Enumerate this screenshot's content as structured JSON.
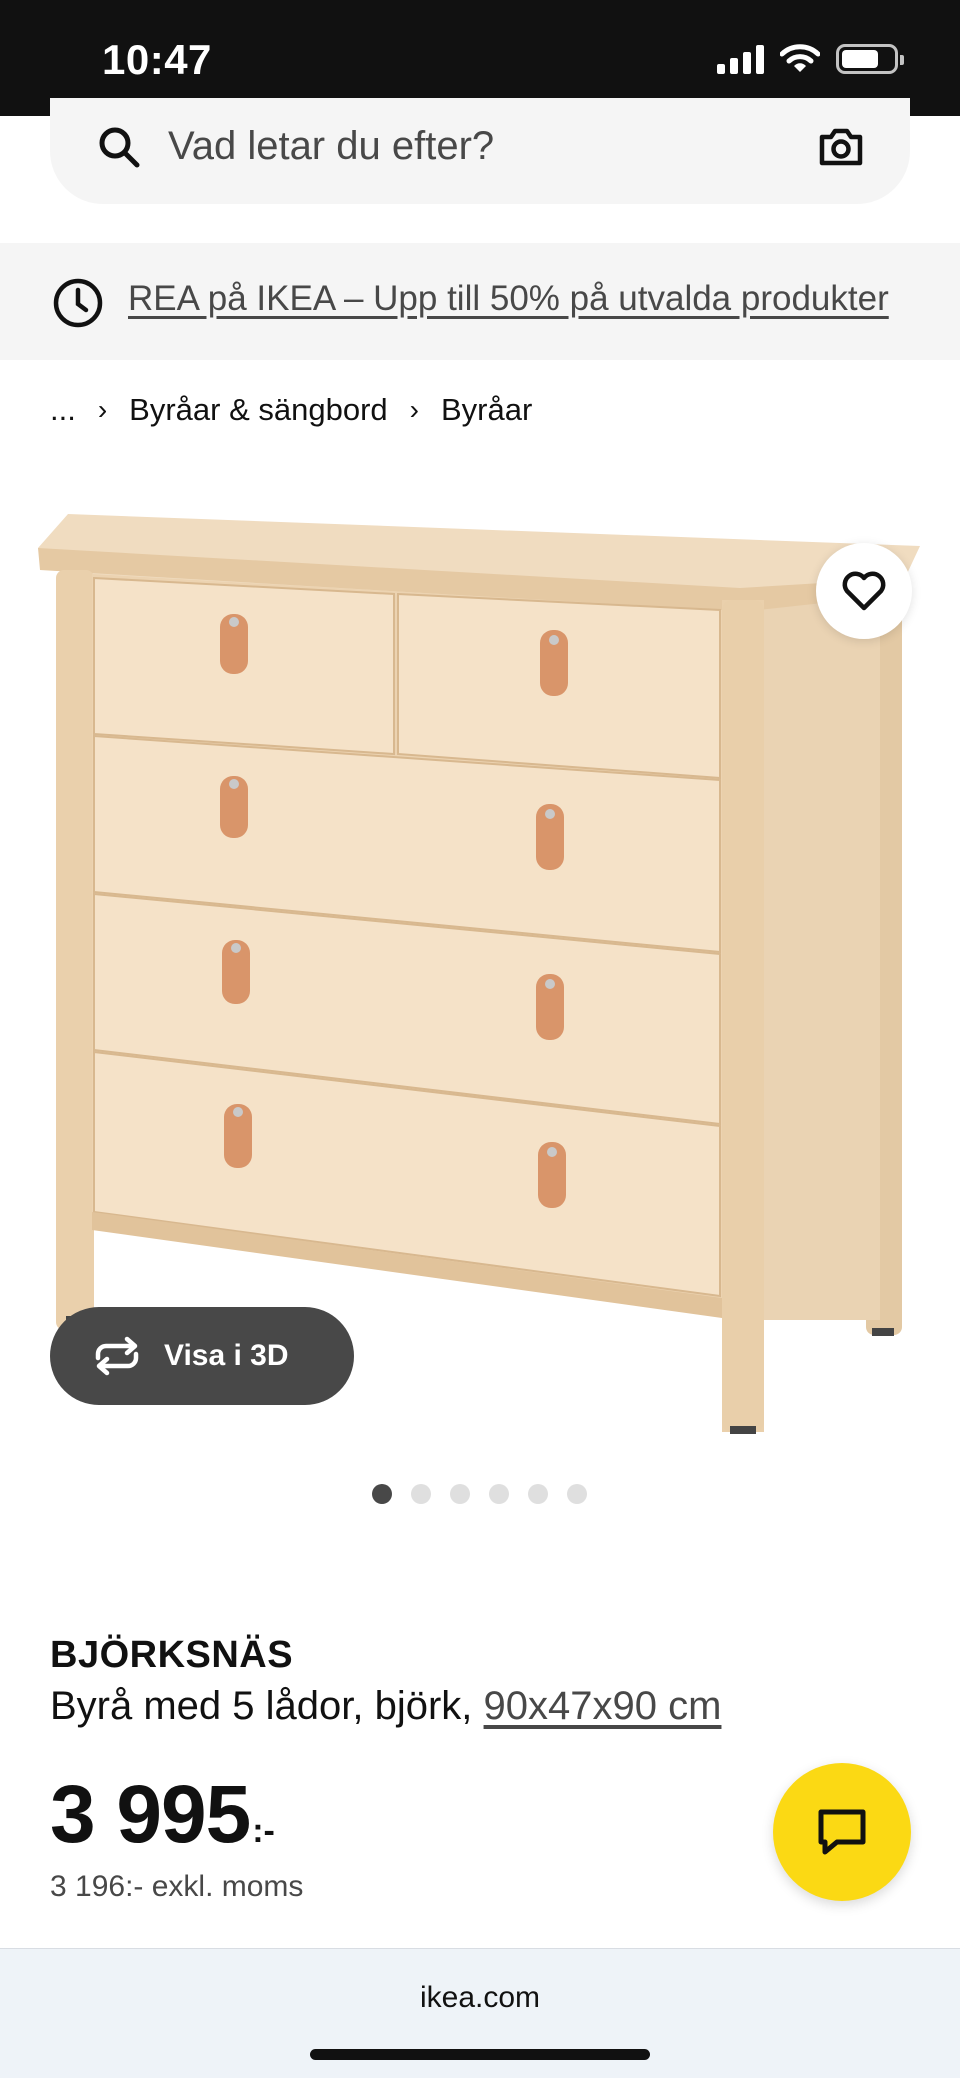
{
  "status_bar": {
    "time": "10:47",
    "icons": [
      "signal-icon",
      "wifi-icon",
      "battery-icon"
    ]
  },
  "search": {
    "placeholder": "Vad letar du efter?",
    "icons": [
      "search-icon",
      "camera-icon"
    ]
  },
  "promo": {
    "text": "REA på IKEA – Upp till 50% på utvalda produkter",
    "icon": "clock-icon"
  },
  "breadcrumb": {
    "ellipsis": "...",
    "items": [
      "Byråar & sängbord",
      "Byråar"
    ]
  },
  "gallery": {
    "view_3d_label": "Visa i 3D",
    "image_count": 6,
    "active_index": 0,
    "favorite_icon": "heart-icon"
  },
  "product": {
    "name": "BJÖRKSNÄS",
    "description": "Byrå med 5 lådor, björk, ",
    "dimensions": "90x47x90 cm",
    "price": "3 995",
    "price_suffix": ":-",
    "price_excl_vat": "3 196:- exkl. moms"
  },
  "chat": {
    "icon": "chat-icon"
  },
  "browser": {
    "url": "ikea.com"
  },
  "colors": {
    "accent_yellow": "#FBD914",
    "dark_button": "#484848",
    "wood": "#EED9BC",
    "leather": "#D9956A"
  }
}
